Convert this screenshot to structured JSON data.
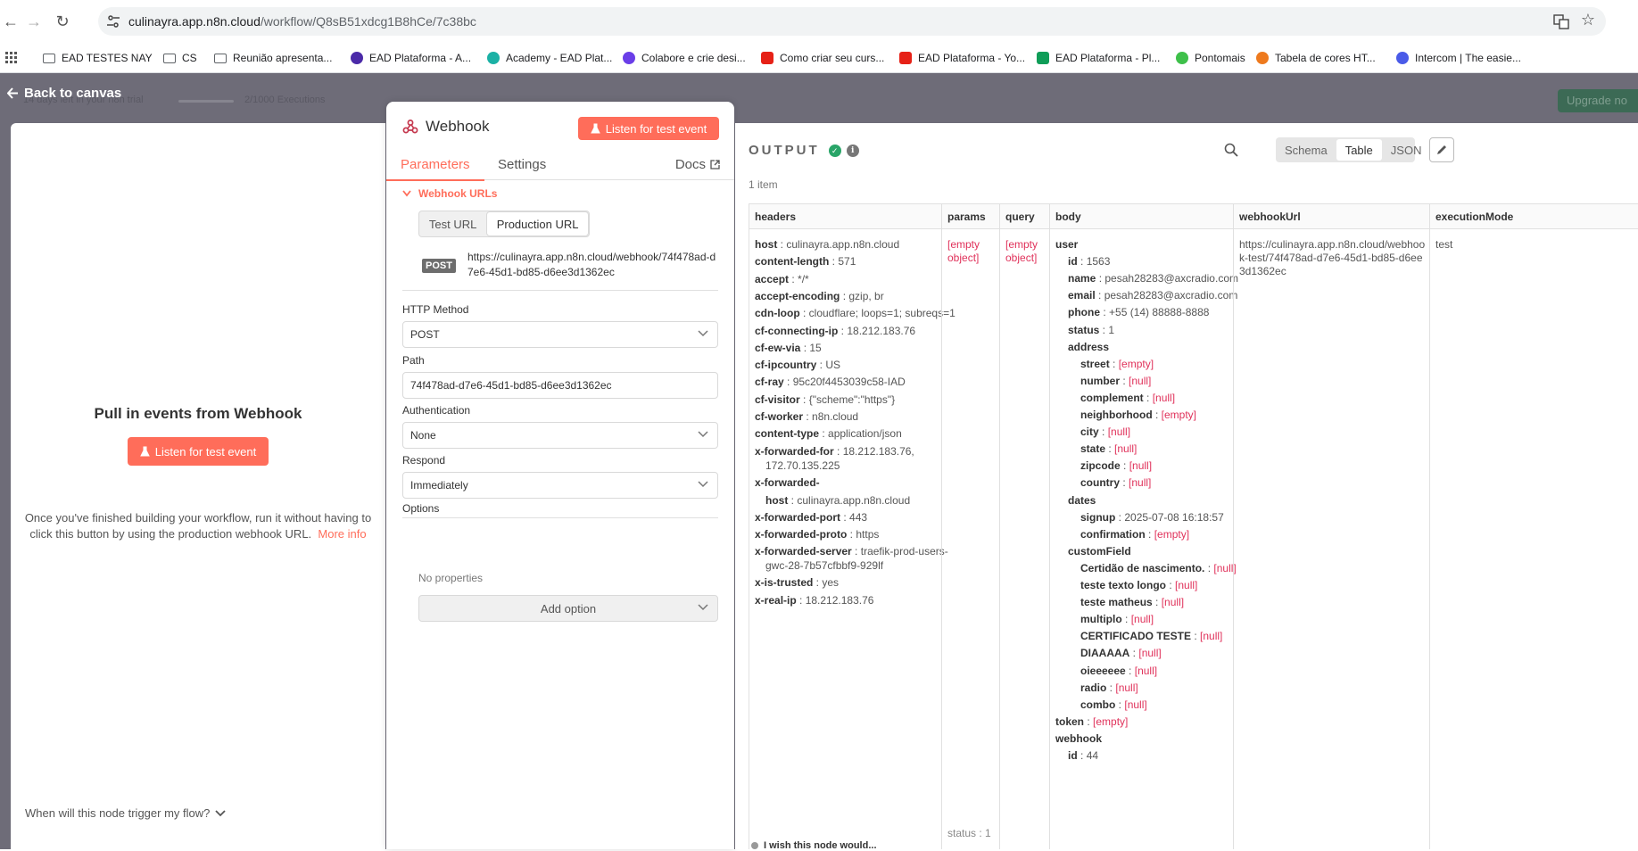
{
  "browser": {
    "url_host": "culinayra.app.n8n.cloud",
    "url_path": "/workflow/Q8sB51xdcg1B8hCe/7c38bc",
    "bookmarks": [
      {
        "label": "EAD TESTES NAY",
        "icon": "folder-icon"
      },
      {
        "label": "CS",
        "icon": "folder-icon"
      },
      {
        "label": "Reunião apresenta...",
        "icon": "folder-icon"
      },
      {
        "label": "EAD Plataforma - A...",
        "icon": "site-icon",
        "color": "#4b2aa8"
      },
      {
        "label": "Academy - EAD Plat...",
        "icon": "site-icon",
        "color": "#1bb1a5"
      },
      {
        "label": "Colabore e crie desi...",
        "icon": "site-icon",
        "color": "#6a3ee8"
      },
      {
        "label": "Como criar seu curs...",
        "icon": "youtube-icon",
        "color": "#e62117"
      },
      {
        "label": "EAD Plataforma - Yo...",
        "icon": "youtube-icon",
        "color": "#e62117"
      },
      {
        "label": "EAD Plataforma - Pl...",
        "icon": "sheets-icon",
        "color": "#0f9d58"
      },
      {
        "label": "Pontomais",
        "icon": "site-icon",
        "color": "#3ec04a"
      },
      {
        "label": "Tabela de cores HT...",
        "icon": "site-icon",
        "color": "#ee7a1e"
      },
      {
        "label": "Intercom | The easie...",
        "icon": "site-icon",
        "color": "#4a5be8"
      }
    ]
  },
  "backdrop": {
    "trial": "14 days left in your n8n trial",
    "executions": "2/1000 Executions",
    "upgrade": "Upgrade no"
  },
  "back_to_canvas": "Back to canvas",
  "left_panel": {
    "title": "Pull in events from Webhook",
    "listen_button": "Listen for test event",
    "hint": "Once you've finished building your workflow, run it without having to click this button by using the production webhook URL.",
    "more_info": "More info",
    "when": "When will this node trigger my flow?"
  },
  "node": {
    "title": "Webhook",
    "listen_button": "Listen for test event",
    "tabs": {
      "parameters": "Parameters",
      "settings": "Settings",
      "docs": "Docs"
    },
    "section_webhook_urls": "Webhook URLs",
    "url_tabs": {
      "test": "Test URL",
      "production": "Production URL"
    },
    "method_badge": "POST",
    "webhook_url": "https://culinayra.app.n8n.cloud/webhook/74f478ad-d7e6-45d1-bd85-d6ee3d1362ec",
    "http_method_label": "HTTP Method",
    "http_method_value": "POST",
    "path_label": "Path",
    "path_value": "74f478ad-d7e6-45d1-bd85-d6ee3d1362ec",
    "auth_label": "Authentication",
    "auth_value": "None",
    "respond_label": "Respond",
    "respond_value": "Immediately",
    "options_label": "Options",
    "no_properties": "No properties",
    "add_option": "Add option"
  },
  "output": {
    "title": "OUTPUT",
    "item_count": "1 item",
    "views": [
      "Schema",
      "Table",
      "JSON"
    ],
    "active_view": "Table",
    "columns": [
      "headers",
      "params",
      "query",
      "body",
      "webhookUrl",
      "executionMode"
    ],
    "headers": [
      {
        "k": "host",
        "v": "culinayra.app.n8n.cloud"
      },
      {
        "k": "content-length",
        "v": "571"
      },
      {
        "k": "accept",
        "v": "*/*"
      },
      {
        "k": "accept-encoding",
        "v": "gzip, br"
      },
      {
        "k": "cdn-loop",
        "v": "cloudflare; loops=1; subreqs=1"
      },
      {
        "k": "cf-connecting-ip",
        "v": "18.212.183.76"
      },
      {
        "k": "cf-ew-via",
        "v": "15"
      },
      {
        "k": "cf-ipcountry",
        "v": "US"
      },
      {
        "k": "cf-ray",
        "v": "95c20f4453039c58-IAD"
      },
      {
        "k": "cf-visitor",
        "v": "{\"scheme\":\"https\"}"
      },
      {
        "k": "cf-worker",
        "v": "n8n.cloud"
      },
      {
        "k": "content-type",
        "v": "application/json"
      },
      {
        "k": "x-forwarded-for",
        "v": "18.212.183.76,",
        "v2": "172.70.135.225"
      },
      {
        "k": "x-forwarded-",
        "k2": "host",
        "v": "culinayra.app.n8n.cloud"
      },
      {
        "k": "x-forwarded-port",
        "v": "443"
      },
      {
        "k": "x-forwarded-proto",
        "v": "https"
      },
      {
        "k": "x-forwarded-server",
        "v": "traefik-prod-users-",
        "v2": "gwc-28-7b57cfbbf9-929lf"
      },
      {
        "k": "x-is-trusted",
        "v": "yes"
      },
      {
        "k": "x-real-ip",
        "v": "18.212.183.76"
      }
    ],
    "params_value": "[empty object]",
    "query_value": "[empty object]",
    "body": {
      "user_key": "user",
      "user": [
        {
          "k": "id",
          "v": "1563"
        },
        {
          "k": "name",
          "v": "pesah28283@axcradio.com"
        },
        {
          "k": "email",
          "v": "pesah28283@axcradio.com"
        },
        {
          "k": "phone",
          "v": "+55 (14) 88888-8888"
        },
        {
          "k": "status",
          "v": "1"
        }
      ],
      "address_key": "address",
      "address": [
        {
          "k": "street",
          "v": "[empty]"
        },
        {
          "k": "number",
          "v": "[null]"
        },
        {
          "k": "complement",
          "v": "[null]"
        },
        {
          "k": "neighborhood",
          "v": "[empty]"
        },
        {
          "k": "city",
          "v": "[null]"
        },
        {
          "k": "state",
          "v": "[null]"
        },
        {
          "k": "zipcode",
          "v": "[null]"
        },
        {
          "k": "country",
          "v": "[null]"
        }
      ],
      "dates_key": "dates",
      "dates": [
        {
          "k": "signup",
          "v": "2025-07-08 16:18:57"
        },
        {
          "k": "confirmation",
          "v": "[empty]"
        }
      ],
      "custom_key": "customField",
      "custom": [
        {
          "k": "Certidão de nascimento.",
          "v": "[null]"
        },
        {
          "k": "teste texto longo",
          "v": "[null]"
        },
        {
          "k": "teste matheus",
          "v": "[null]"
        },
        {
          "k": "multiplo",
          "v": "[null]"
        },
        {
          "k": "CERTIFICADO TESTE",
          "v": "[null]"
        },
        {
          "k": "DIAAAAA",
          "v": "[null]"
        },
        {
          "k": "oieeeeee",
          "v": "[null]"
        },
        {
          "k": "radio",
          "v": "[null]"
        },
        {
          "k": "combo",
          "v": "[null]"
        }
      ],
      "token_key": "token",
      "token_value": "[empty]",
      "webhook_key": "webhook",
      "webhook_id_key": "id",
      "webhook_id_value": "44"
    },
    "webhook_url_value": "https://culinayra.app.n8n.cloud/webhook-test/74f478ad-d7e6-45d1-bd85-d6ee3d1362ec",
    "execution_mode_value": "test",
    "status_hint": "status : 1",
    "wish_hint": "I wish this node would..."
  }
}
